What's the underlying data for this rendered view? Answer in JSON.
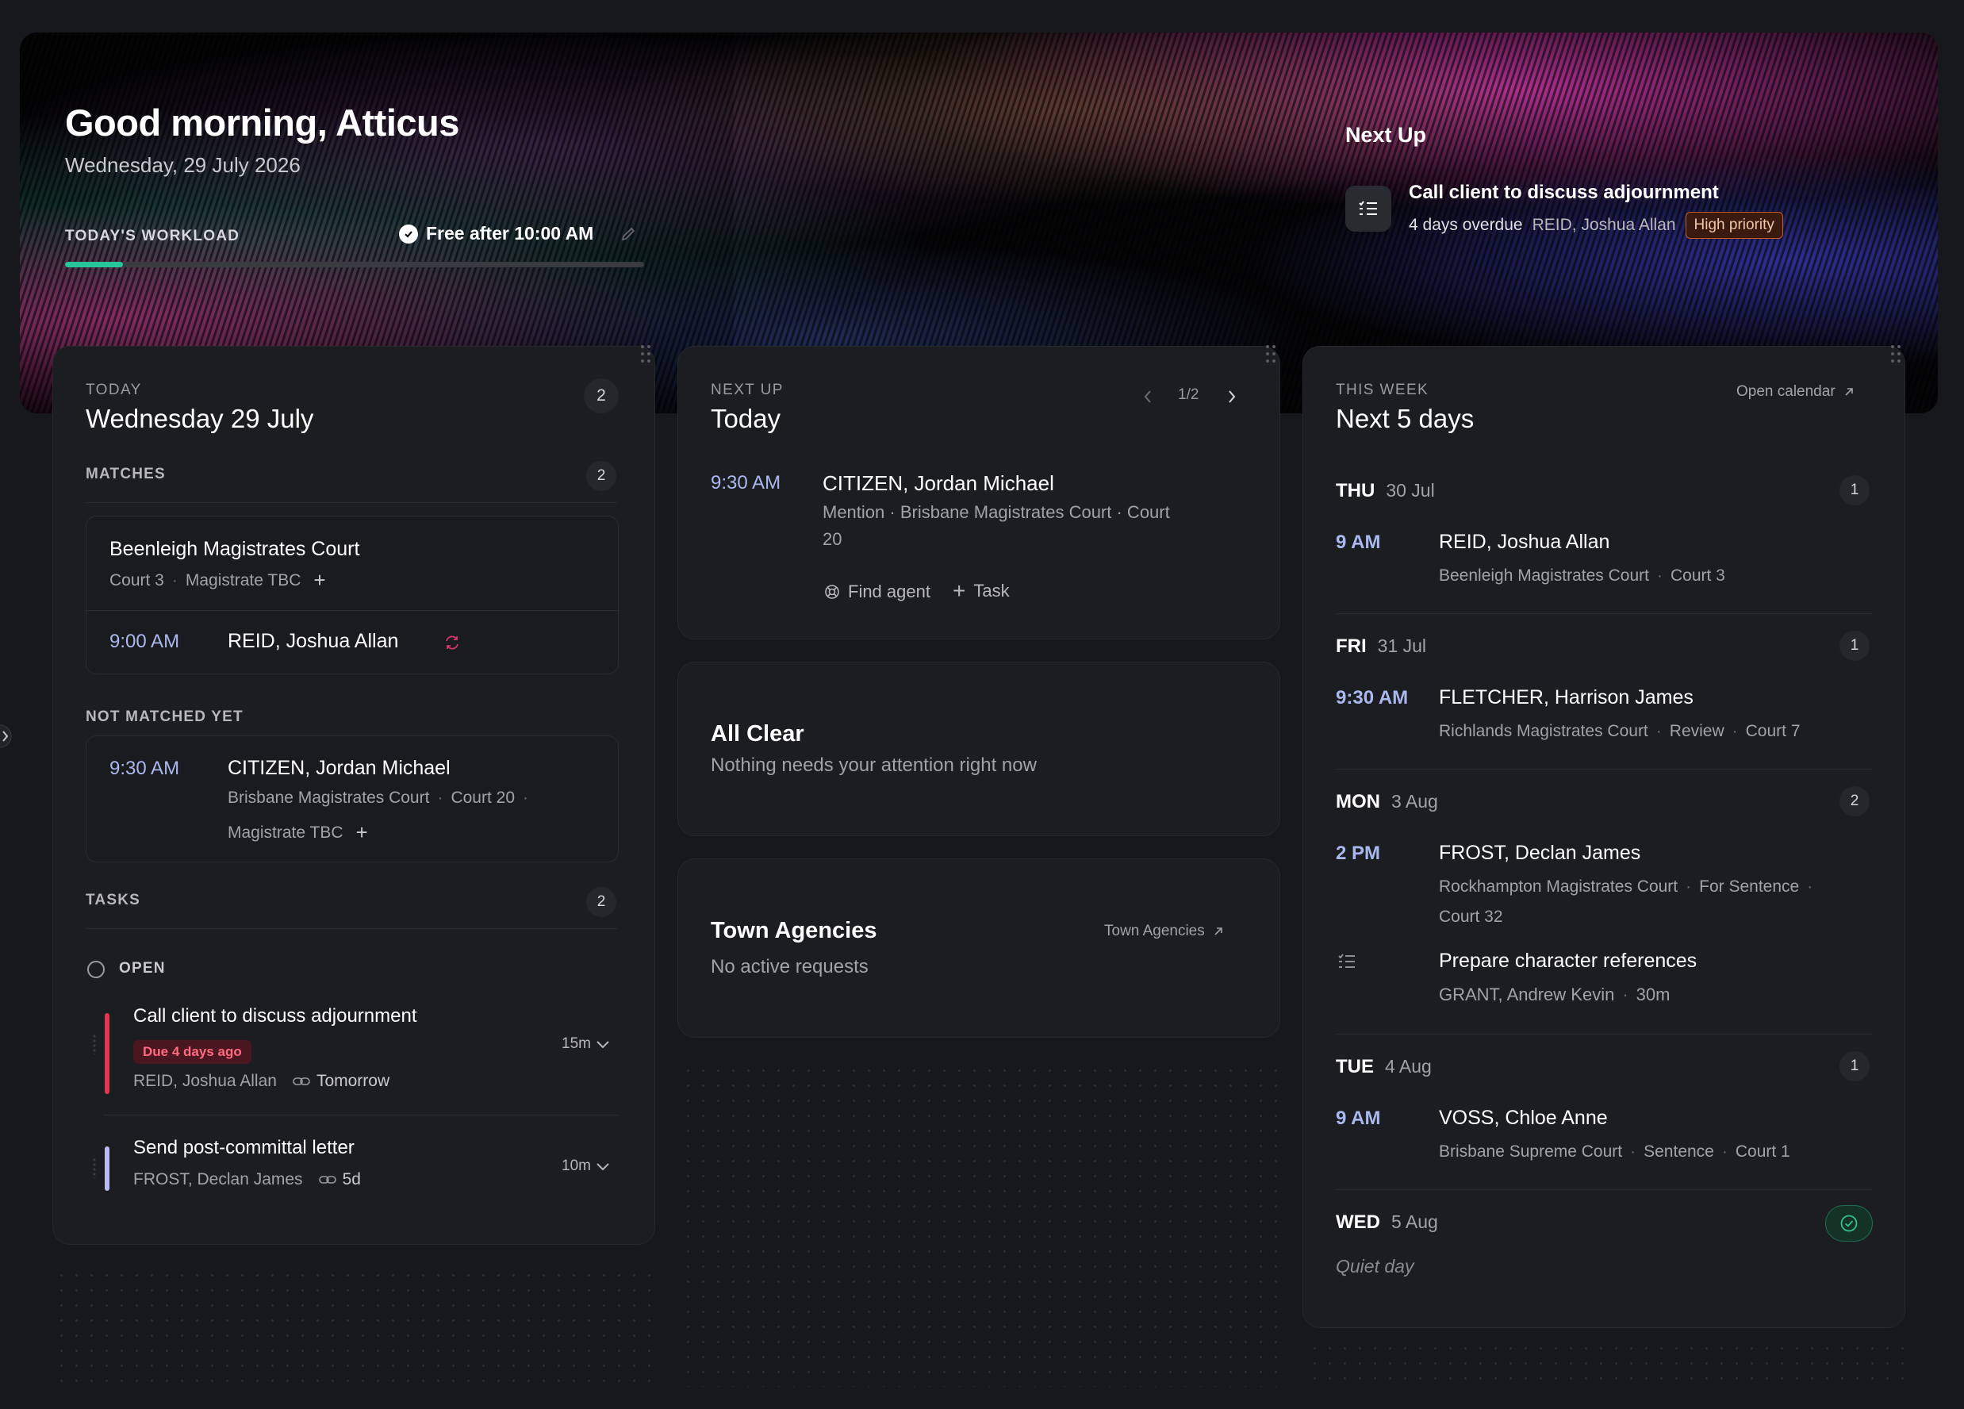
{
  "hero": {
    "greeting": "Good morning, Atticus",
    "date": "Wednesday, 29 July 2026",
    "workload_label": "TODAY'S WORKLOAD",
    "free_after": "Free after 10:00 AM",
    "workload_progress": 0.1,
    "next_up": {
      "title": "Next Up",
      "task": "Call client to discuss adjournment",
      "overdue": "4 days overdue",
      "client": "REID, Joshua Allan",
      "priority": "High priority"
    }
  },
  "today": {
    "eyebrow": "TODAY",
    "title": "Wednesday 29 July",
    "count": "2",
    "matches": {
      "label": "MATCHES",
      "count": "2",
      "court": "Beenleigh Magistrates Court",
      "court_no": "Court 3",
      "magistrate": "Magistrate TBC",
      "time": "9:00 AM",
      "client": "REID, Joshua Allan"
    },
    "not_matched": {
      "label": "NOT MATCHED YET",
      "time": "9:30 AM",
      "client": "CITIZEN, Jordan Michael",
      "court": "Brisbane Magistrates Court",
      "court_no": "Court 20",
      "magistrate": "Magistrate TBC"
    },
    "tasks": {
      "label": "TASKS",
      "count": "2",
      "open_label": "OPEN",
      "items": [
        {
          "title": "Call client to discuss adjournment",
          "due": "Due 4 days ago",
          "client": "REID, Joshua Allan",
          "link": "Tomorrow",
          "duration": "15m"
        },
        {
          "title": "Send post-committal letter",
          "client": "FROST, Declan James",
          "link": "5d",
          "duration": "10m"
        }
      ]
    }
  },
  "next_up_card": {
    "eyebrow": "NEXT UP",
    "title": "Today",
    "pager": "1/2",
    "time": "9:30 AM",
    "client": "CITIZEN, Jordan Michael",
    "detail_line1": "Mention · Brisbane Magistrates Court · Court",
    "detail_line2": "20",
    "find_agent": "Find agent",
    "task": "Task"
  },
  "all_clear": {
    "title": "All Clear",
    "subtitle": "Nothing needs your attention right now"
  },
  "town_agencies": {
    "title": "Town Agencies",
    "link": "Town Agencies",
    "subtitle": "No active requests"
  },
  "week": {
    "eyebrow": "THIS WEEK",
    "title": "Next 5 days",
    "open_calendar": "Open calendar",
    "days": [
      {
        "day": "THU",
        "date": "30 Jul",
        "count": "1",
        "time": "9 AM",
        "client": "REID, Joshua Allan",
        "m1": "Beenleigh Magistrates Court",
        "m2": "Court 3"
      },
      {
        "day": "FRI",
        "date": "31 Jul",
        "count": "1",
        "time": "9:30 AM",
        "client": "FLETCHER, Harrison James",
        "m1": "Richlands Magistrates Court",
        "m2": "Review",
        "m3": "Court 7"
      },
      {
        "day": "MON",
        "date": "3 Aug",
        "count": "2",
        "time": "2 PM",
        "client": "FROST, Declan James",
        "m1": "Rockhampton Magistrates Court",
        "m2": "For Sentence",
        "m3": "Court 32",
        "task": "Prepare character references",
        "task_client": "GRANT, Andrew Kevin",
        "task_dur": "30m"
      },
      {
        "day": "TUE",
        "date": "4 Aug",
        "count": "1",
        "time": "9 AM",
        "client": "VOSS, Chloe Anne",
        "m1": "Brisbane Supreme Court",
        "m2": "Sentence",
        "m3": "Court 1"
      },
      {
        "day": "WED",
        "date": "5 Aug",
        "quiet": "Quiet day"
      }
    ]
  },
  "colors": {
    "accent_time": "#a9b9f0",
    "progress": "#27c59a",
    "task_red": "#e0364f",
    "task_lavender": "#b9b9f7"
  }
}
